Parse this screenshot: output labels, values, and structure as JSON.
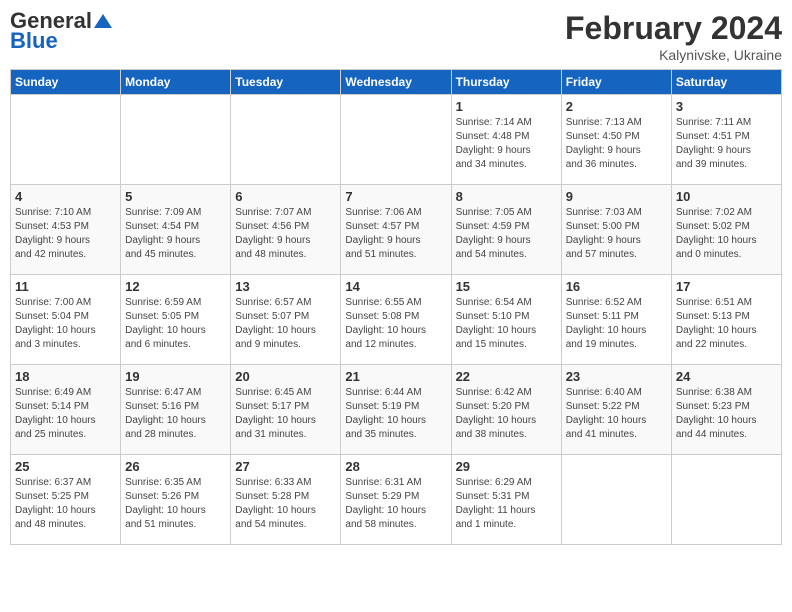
{
  "header": {
    "logo_general": "General",
    "logo_blue": "Blue",
    "month_title": "February 2024",
    "location": "Kalynivske, Ukraine"
  },
  "days_of_week": [
    "Sunday",
    "Monday",
    "Tuesday",
    "Wednesday",
    "Thursday",
    "Friday",
    "Saturday"
  ],
  "weeks": [
    [
      {
        "day": "",
        "info": ""
      },
      {
        "day": "",
        "info": ""
      },
      {
        "day": "",
        "info": ""
      },
      {
        "day": "",
        "info": ""
      },
      {
        "day": "1",
        "info": "Sunrise: 7:14 AM\nSunset: 4:48 PM\nDaylight: 9 hours\nand 34 minutes."
      },
      {
        "day": "2",
        "info": "Sunrise: 7:13 AM\nSunset: 4:50 PM\nDaylight: 9 hours\nand 36 minutes."
      },
      {
        "day": "3",
        "info": "Sunrise: 7:11 AM\nSunset: 4:51 PM\nDaylight: 9 hours\nand 39 minutes."
      }
    ],
    [
      {
        "day": "4",
        "info": "Sunrise: 7:10 AM\nSunset: 4:53 PM\nDaylight: 9 hours\nand 42 minutes."
      },
      {
        "day": "5",
        "info": "Sunrise: 7:09 AM\nSunset: 4:54 PM\nDaylight: 9 hours\nand 45 minutes."
      },
      {
        "day": "6",
        "info": "Sunrise: 7:07 AM\nSunset: 4:56 PM\nDaylight: 9 hours\nand 48 minutes."
      },
      {
        "day": "7",
        "info": "Sunrise: 7:06 AM\nSunset: 4:57 PM\nDaylight: 9 hours\nand 51 minutes."
      },
      {
        "day": "8",
        "info": "Sunrise: 7:05 AM\nSunset: 4:59 PM\nDaylight: 9 hours\nand 54 minutes."
      },
      {
        "day": "9",
        "info": "Sunrise: 7:03 AM\nSunset: 5:00 PM\nDaylight: 9 hours\nand 57 minutes."
      },
      {
        "day": "10",
        "info": "Sunrise: 7:02 AM\nSunset: 5:02 PM\nDaylight: 10 hours\nand 0 minutes."
      }
    ],
    [
      {
        "day": "11",
        "info": "Sunrise: 7:00 AM\nSunset: 5:04 PM\nDaylight: 10 hours\nand 3 minutes."
      },
      {
        "day": "12",
        "info": "Sunrise: 6:59 AM\nSunset: 5:05 PM\nDaylight: 10 hours\nand 6 minutes."
      },
      {
        "day": "13",
        "info": "Sunrise: 6:57 AM\nSunset: 5:07 PM\nDaylight: 10 hours\nand 9 minutes."
      },
      {
        "day": "14",
        "info": "Sunrise: 6:55 AM\nSunset: 5:08 PM\nDaylight: 10 hours\nand 12 minutes."
      },
      {
        "day": "15",
        "info": "Sunrise: 6:54 AM\nSunset: 5:10 PM\nDaylight: 10 hours\nand 15 minutes."
      },
      {
        "day": "16",
        "info": "Sunrise: 6:52 AM\nSunset: 5:11 PM\nDaylight: 10 hours\nand 19 minutes."
      },
      {
        "day": "17",
        "info": "Sunrise: 6:51 AM\nSunset: 5:13 PM\nDaylight: 10 hours\nand 22 minutes."
      }
    ],
    [
      {
        "day": "18",
        "info": "Sunrise: 6:49 AM\nSunset: 5:14 PM\nDaylight: 10 hours\nand 25 minutes."
      },
      {
        "day": "19",
        "info": "Sunrise: 6:47 AM\nSunset: 5:16 PM\nDaylight: 10 hours\nand 28 minutes."
      },
      {
        "day": "20",
        "info": "Sunrise: 6:45 AM\nSunset: 5:17 PM\nDaylight: 10 hours\nand 31 minutes."
      },
      {
        "day": "21",
        "info": "Sunrise: 6:44 AM\nSunset: 5:19 PM\nDaylight: 10 hours\nand 35 minutes."
      },
      {
        "day": "22",
        "info": "Sunrise: 6:42 AM\nSunset: 5:20 PM\nDaylight: 10 hours\nand 38 minutes."
      },
      {
        "day": "23",
        "info": "Sunrise: 6:40 AM\nSunset: 5:22 PM\nDaylight: 10 hours\nand 41 minutes."
      },
      {
        "day": "24",
        "info": "Sunrise: 6:38 AM\nSunset: 5:23 PM\nDaylight: 10 hours\nand 44 minutes."
      }
    ],
    [
      {
        "day": "25",
        "info": "Sunrise: 6:37 AM\nSunset: 5:25 PM\nDaylight: 10 hours\nand 48 minutes."
      },
      {
        "day": "26",
        "info": "Sunrise: 6:35 AM\nSunset: 5:26 PM\nDaylight: 10 hours\nand 51 minutes."
      },
      {
        "day": "27",
        "info": "Sunrise: 6:33 AM\nSunset: 5:28 PM\nDaylight: 10 hours\nand 54 minutes."
      },
      {
        "day": "28",
        "info": "Sunrise: 6:31 AM\nSunset: 5:29 PM\nDaylight: 10 hours\nand 58 minutes."
      },
      {
        "day": "29",
        "info": "Sunrise: 6:29 AM\nSunset: 5:31 PM\nDaylight: 11 hours\nand 1 minute."
      },
      {
        "day": "",
        "info": ""
      },
      {
        "day": "",
        "info": ""
      }
    ]
  ]
}
